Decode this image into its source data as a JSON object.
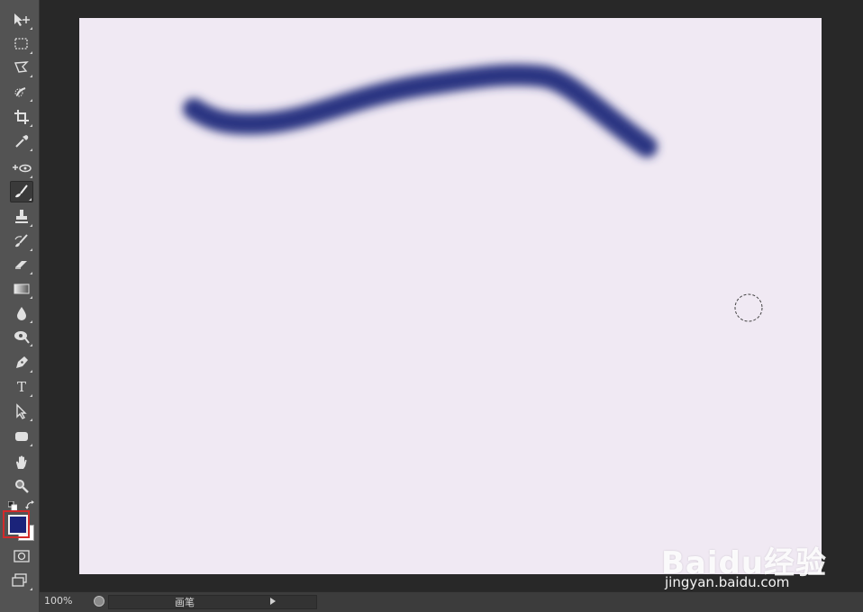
{
  "colors": {
    "toolbar": "#535353",
    "workspace": "#282828",
    "canvas": "#f0e9f3",
    "stroke": "#2c3682",
    "foreground": "#1b237a",
    "background": "#ffffff",
    "highlight": "#d32a2a"
  },
  "toolbar": {
    "tools": [
      "move-tool",
      "marquee-tool",
      "lasso-tool",
      "quick-selection-tool",
      "crop-tool",
      "eyedropper-tool",
      "spot-healing-tool",
      "brush-tool",
      "clone-stamp-tool",
      "history-brush-tool",
      "eraser-tool",
      "gradient-tool",
      "blur-tool",
      "dodge-tool",
      "pen-tool",
      "type-tool",
      "path-selection-tool",
      "rectangle-tool",
      "hand-tool",
      "zoom-tool"
    ],
    "active_tool": "brush-tool",
    "type_glyph": "T"
  },
  "status": {
    "zoom": "100%",
    "label": "画笔"
  },
  "watermark": {
    "logo": "Baidu经验",
    "url": "jingyan.baidu.com"
  }
}
